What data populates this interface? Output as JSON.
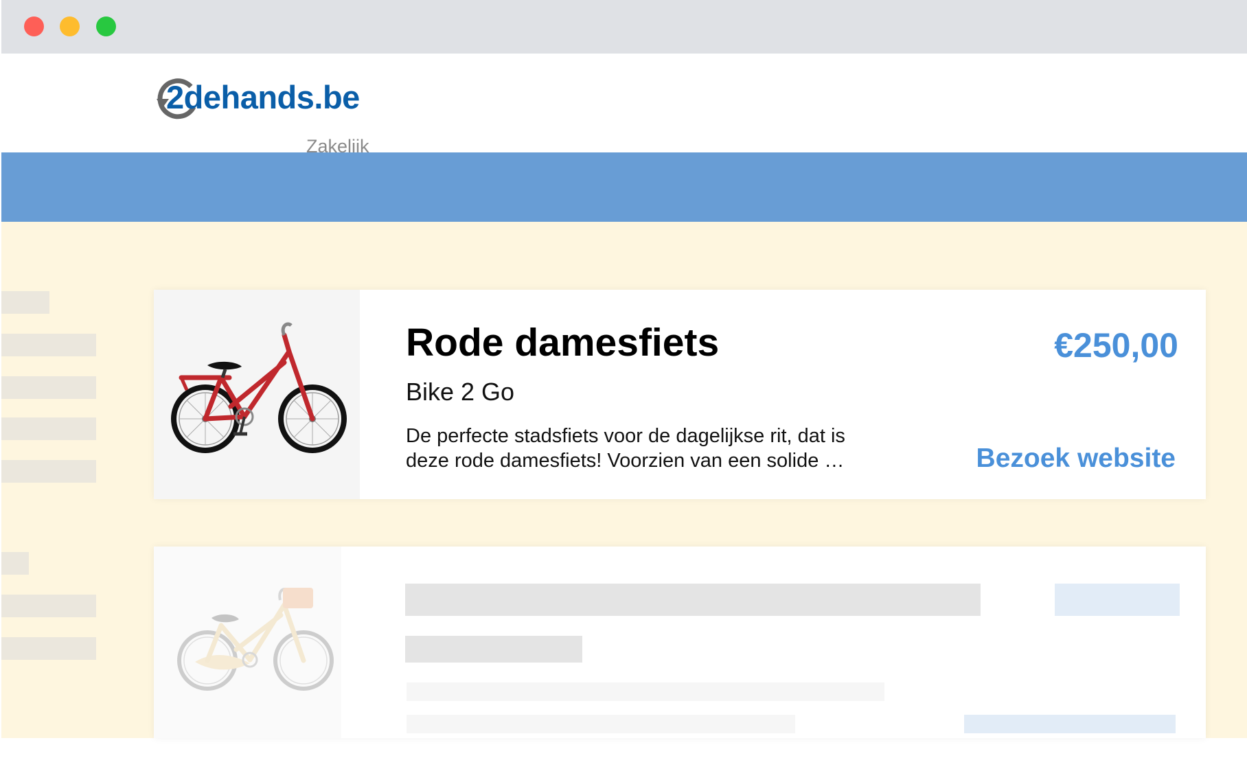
{
  "window": {
    "controls": [
      "close",
      "minimize",
      "maximize"
    ]
  },
  "header": {
    "logo_text": "2dehands.be",
    "logo_subtext": "Zakelijk"
  },
  "colors": {
    "brand_blue": "#0a5ea8",
    "accent_blue": "#4a90d9",
    "nav_bar": "#689dd5",
    "content_background": "#fef6df"
  },
  "listing": {
    "title": "Rode damesfiets",
    "seller": "Bike 2 Go",
    "description_line1": "De perfecte stadsfiets voor de dagelijkse rit, dat is",
    "description_line2": "deze rode damesfiets! Voorzien van een solide …",
    "price": "€250,00",
    "cta": "Bezoek website",
    "image": "red-ladies-bicycle"
  },
  "placeholder_listing": {
    "image": "faded-cream-bicycle-with-basket"
  }
}
